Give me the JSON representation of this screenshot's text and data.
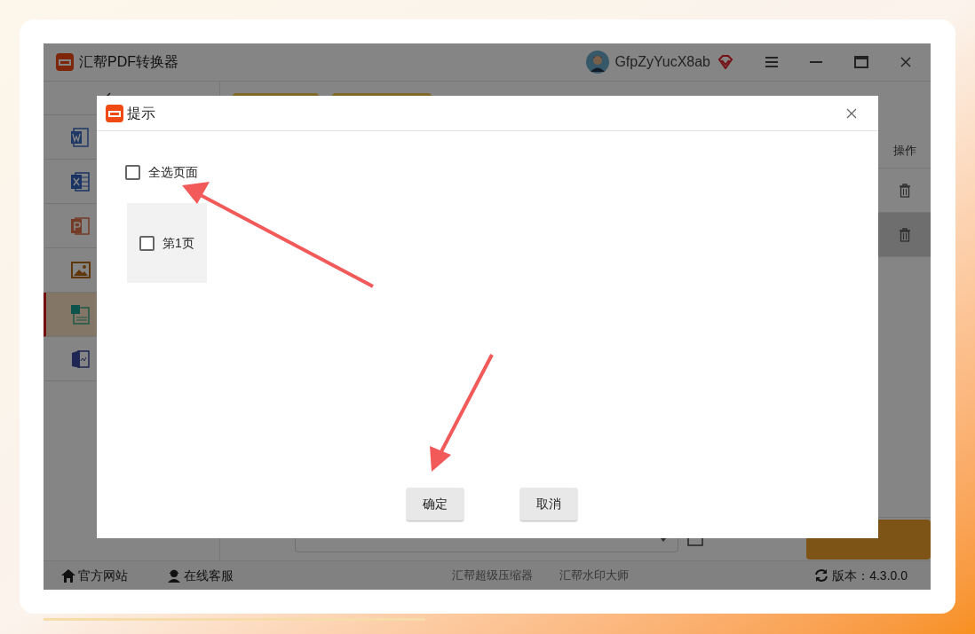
{
  "app": {
    "title": "汇帮PDF转换器",
    "user": "GfpZyYucX8ab"
  },
  "sidebar": {
    "items": [
      {
        "kind": "word",
        "selected": false
      },
      {
        "kind": "excel",
        "selected": false
      },
      {
        "kind": "ppt",
        "selected": false
      },
      {
        "kind": "image",
        "selected": false
      },
      {
        "kind": "doc",
        "selected": true
      },
      {
        "kind": "book",
        "selected": false
      }
    ]
  },
  "table": {
    "columns": [
      "操作"
    ],
    "rows": [
      {
        "shaded": false
      },
      {
        "shaded": true
      }
    ]
  },
  "status_bar": {
    "links": [
      "官方网站",
      "在线客服"
    ],
    "products": [
      "汇帮超级压缩器",
      "汇帮水印大师"
    ],
    "version": "版本：4.3.0.0"
  },
  "dialog": {
    "title": "提示",
    "select_all": {
      "label": "全选页面",
      "checked": false
    },
    "pages": [
      {
        "label": "第1页",
        "checked": false
      }
    ],
    "buttons": [
      "确定",
      "取消"
    ]
  }
}
